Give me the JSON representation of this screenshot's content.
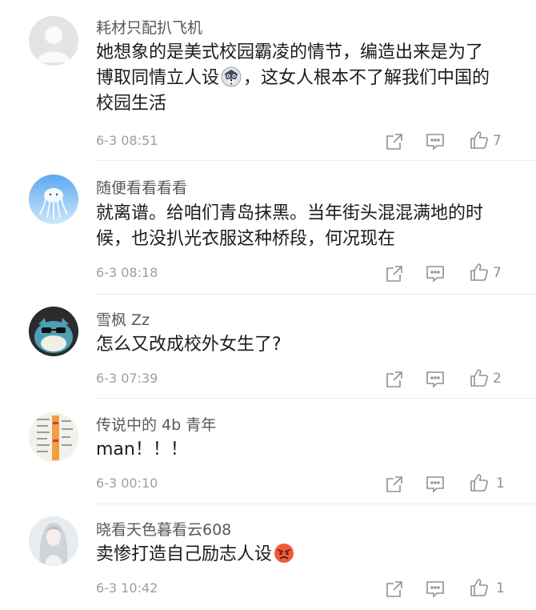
{
  "comments": [
    {
      "username": "耗材只配扒飞机",
      "text_before_emoji": "她想象的是美式校园霸凌的情节，编造出来是为了博取同情立人设",
      "emoji": "husky-face-emoji",
      "text_after_emoji": "，这女人根本不了解我们中国的校园生活",
      "time": "6-3 08:51",
      "likes": "7"
    },
    {
      "username": "随便看看看看",
      "text": "就离谱。给咱们青岛抹黑。当年街头混混满地的时候，也没扒光衣服这种桥段，何况现在",
      "time": "6-3 08:18",
      "likes": "7"
    },
    {
      "username": "雪枫 Zz",
      "text": "怎么又改成校外女生了?",
      "time": "6-3 07:39",
      "likes": "2"
    },
    {
      "username": "传说中的 4b 青年",
      "text": "man！！！",
      "time": "6-3 00:10",
      "likes": "1"
    },
    {
      "username": "晓看天色暮看云608",
      "text_before_emoji": "卖惨打造自己励志人设",
      "emoji": "angry-face-emoji",
      "time": "6-3 10:42",
      "likes": "1"
    }
  ],
  "icons": {
    "share": "share-icon",
    "reply": "comment-icon",
    "like": "thumbs-up-icon"
  },
  "colors": {
    "username": "#56595e",
    "text": "#1b1b1b",
    "meta": "#9b9ea3",
    "divider": "#ececec"
  }
}
